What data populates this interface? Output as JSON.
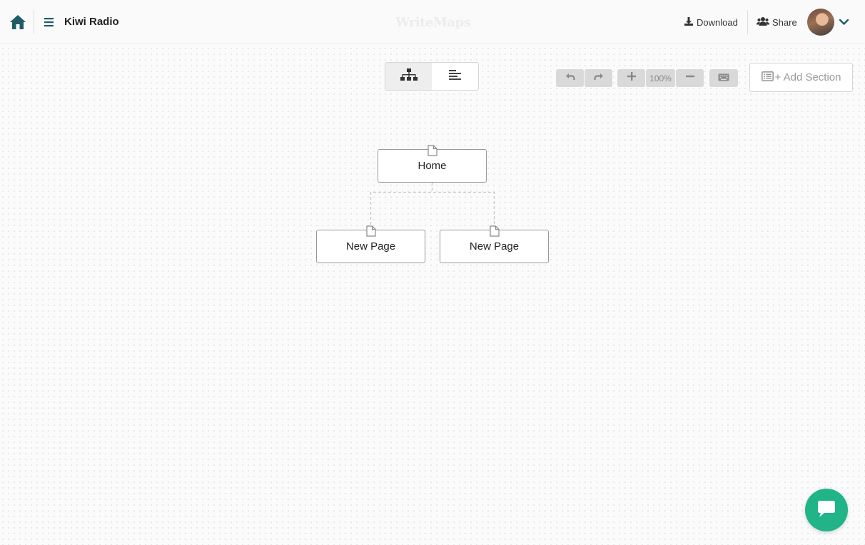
{
  "header": {
    "project_title": "Kiwi Radio",
    "brand": "WriteMaps",
    "download_label": "Download",
    "share_label": "Share"
  },
  "toolbar": {
    "zoom": "100%",
    "add_section_label": "+ Add Section"
  },
  "view_toggle": {
    "active": "tree",
    "options": [
      "tree",
      "outline"
    ]
  },
  "sitemap": {
    "root": {
      "label": "Home"
    },
    "children": [
      {
        "label": "New Page"
      },
      {
        "label": "New Page"
      }
    ]
  },
  "colors": {
    "accent_icon": "#1f5c63",
    "chat": "#20b488"
  },
  "icons": {
    "home": "home-icon",
    "menu": "hamburger-menu-icon",
    "download": "download-icon",
    "share": "users-icon",
    "caret": "chevron-down-icon",
    "tree_view": "sitemap-icon",
    "outline_view": "align-left-icon",
    "undo": "undo-icon",
    "redo": "redo-icon",
    "zoom_in": "plus-icon",
    "zoom_out": "minus-icon",
    "keyboard": "keyboard-icon",
    "add_section": "list-alt-icon",
    "page": "file-icon",
    "chat": "chat-icon"
  }
}
